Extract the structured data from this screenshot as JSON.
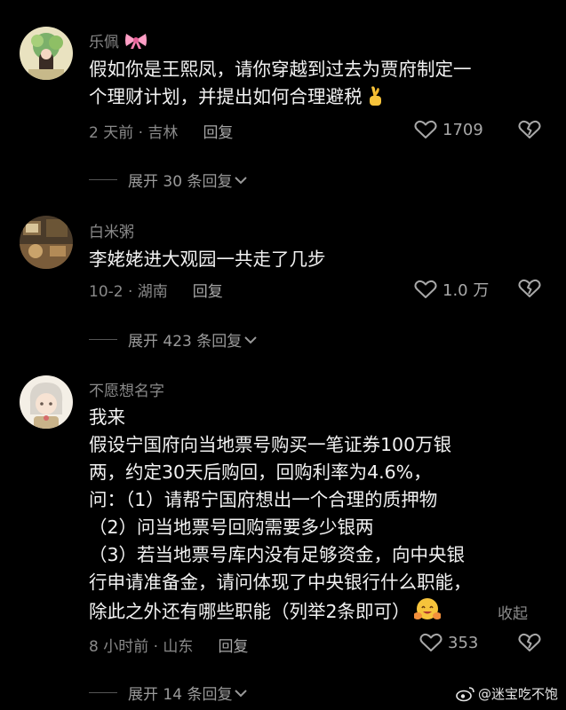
{
  "comments": [
    {
      "username": "乐佩",
      "username_emoji": "ribbon-emoji",
      "lines": [
        "假如你是王熙凤，请你穿越到过去为贾府制定一",
        "个理财计划，并提出如何合理避税"
      ],
      "inline_emoji": "crossed-fingers-emoji",
      "time_location": "2 天前 · 吉林",
      "reply_label": "回复",
      "likes": "1709",
      "expand_label": "展开 30 条回复"
    },
    {
      "username": "白米粥",
      "lines": [
        "李姥姥进大观园一共走了几步"
      ],
      "time_location": "10-2 · 湖南",
      "reply_label": "回复",
      "likes": "1.0 万",
      "expand_label": "展开 423 条回复"
    },
    {
      "username": "不愿想名字",
      "lines": [
        "我来",
        "假设宁国府向当地票号购买一笔证券100万银",
        "两，约定30天后购回，回购利率为4.6%，",
        "问：（1）请帮宁国府想出一个合理的质押物",
        "（2）问当地票号回购需要多少银两",
        "（3）若当地票号库内没有足够资金，向中央银",
        "行申请准备金，请问体现了中央银行什么职能，",
        "除此之外还有哪些职能（列举2条即可）"
      ],
      "inline_emoji": "hugging-face-emoji",
      "collapse_label": "收起",
      "time_location": "8 小时前 · 山东",
      "reply_label": "回复",
      "likes": "353",
      "expand_label": "展开 14 条回复"
    }
  ],
  "watermark": {
    "label": "@迷宝吃不饱",
    "icon": "weibo-icon"
  },
  "colors": {
    "background": "#000000",
    "text_primary": "#f2f2f2",
    "text_secondary": "#8a8a8a"
  }
}
